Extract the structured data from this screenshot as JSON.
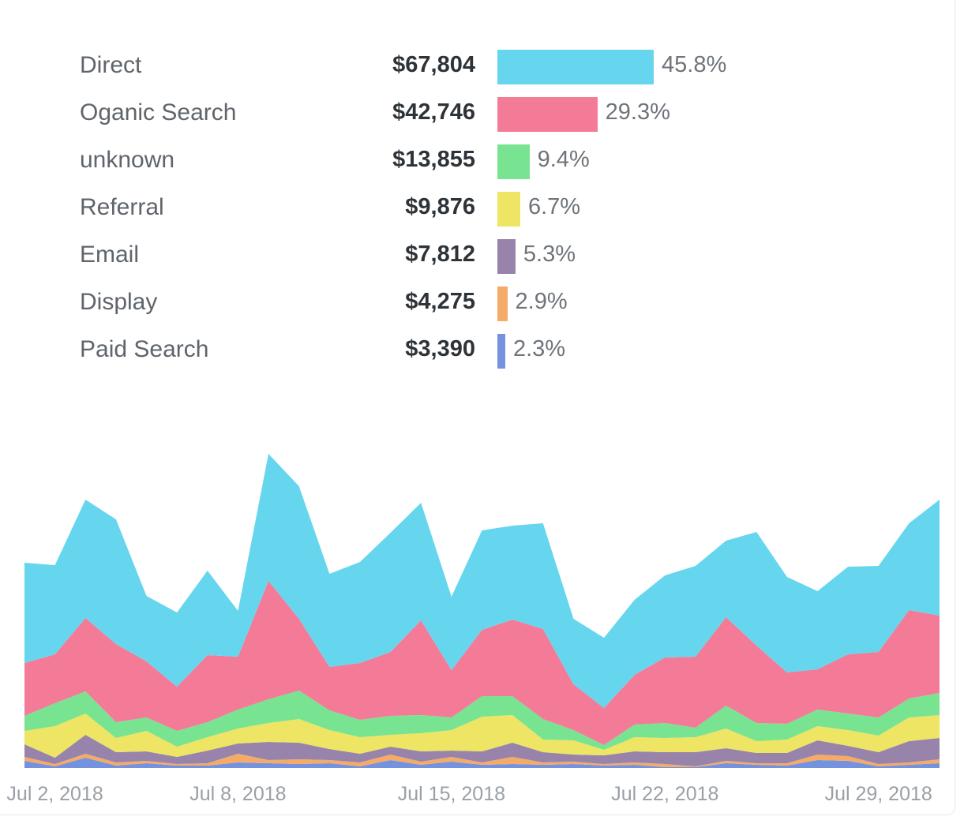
{
  "chart_data": {
    "type": "area",
    "stacked": true,
    "legend_rows": [
      {
        "label": "Direct",
        "amount": "$67,804",
        "percent": "45.8%",
        "share": 45.8,
        "color": "#66d6ee"
      },
      {
        "label": "Oganic Search",
        "amount": "$42,746",
        "percent": "29.3%",
        "share": 29.3,
        "color": "#f47b97"
      },
      {
        "label": "unknown",
        "amount": "$13,855",
        "percent": "9.4%",
        "share": 9.4,
        "color": "#78e391"
      },
      {
        "label": "Referral",
        "amount": "$9,876",
        "percent": "6.7%",
        "share": 6.7,
        "color": "#ede563"
      },
      {
        "label": "Email",
        "amount": "$7,812",
        "percent": "5.3%",
        "share": 5.3,
        "color": "#9884aa"
      },
      {
        "label": "Display",
        "amount": "$4,275",
        "percent": "2.9%",
        "share": 2.9,
        "color": "#f4ab68"
      },
      {
        "label": "Paid Search",
        "amount": "$3,390",
        "percent": "2.3%",
        "share": 2.3,
        "color": "#7492dd"
      }
    ],
    "x": [
      "2018-07-01",
      "2018-07-02",
      "2018-07-03",
      "2018-07-04",
      "2018-07-05",
      "2018-07-06",
      "2018-07-07",
      "2018-07-08",
      "2018-07-09",
      "2018-07-10",
      "2018-07-11",
      "2018-07-12",
      "2018-07-13",
      "2018-07-14",
      "2018-07-15",
      "2018-07-16",
      "2018-07-17",
      "2018-07-18",
      "2018-07-19",
      "2018-07-20",
      "2018-07-21",
      "2018-07-22",
      "2018-07-23",
      "2018-07-24",
      "2018-07-25",
      "2018-07-26",
      "2018-07-27",
      "2018-07-28",
      "2018-07-29",
      "2018-07-30",
      "2018-07-31"
    ],
    "x_tick_labels": [
      "Jul 2, 2018",
      "Jul 8, 2018",
      "Jul 15, 2018",
      "Jul 22, 2018",
      "Jul 29, 2018"
    ],
    "x_tick_dates": [
      "2018-07-02",
      "2018-07-08",
      "2018-07-15",
      "2018-07-22",
      "2018-07-29"
    ],
    "ylim": [
      0,
      400
    ],
    "grid": false,
    "series": [
      {
        "name": "Paid Search",
        "color": "#7492dd",
        "values": [
          9,
          2,
          13,
          3,
          6,
          3,
          3,
          7,
          6,
          5,
          6,
          2,
          10,
          4,
          8,
          4,
          5,
          4,
          5,
          3,
          4,
          1,
          1,
          6,
          4,
          3,
          10,
          9,
          2,
          4,
          6
        ]
      },
      {
        "name": "Display",
        "color": "#f4ab68",
        "values": [
          5,
          3,
          5,
          4,
          3,
          2,
          3,
          11,
          4,
          6,
          4,
          5,
          7,
          4,
          6,
          3,
          9,
          3,
          3,
          2,
          3,
          4,
          1,
          3,
          2,
          3,
          7,
          6,
          3,
          3,
          5
        ]
      },
      {
        "name": "Email",
        "color": "#9884aa",
        "values": [
          16,
          8,
          24,
          13,
          12,
          9,
          16,
          13,
          23,
          21,
          14,
          11,
          10,
          13,
          8,
          14,
          18,
          13,
          9,
          11,
          14,
          15,
          18,
          16,
          13,
          13,
          18,
          13,
          15,
          27,
          27
        ]
      },
      {
        "name": "Referral",
        "color": "#ede563",
        "values": [
          17,
          40,
          27,
          18,
          26,
          13,
          17,
          19,
          24,
          30,
          24,
          21,
          15,
          23,
          26,
          44,
          35,
          16,
          18,
          7,
          18,
          18,
          19,
          25,
          15,
          17,
          18,
          20,
          21,
          30,
          29
        ]
      },
      {
        "name": "unknown",
        "color": "#78e391",
        "values": [
          19,
          29,
          28,
          20,
          17,
          20,
          19,
          24,
          30,
          36,
          25,
          22,
          24,
          23,
          16,
          26,
          24,
          26,
          13,
          6,
          16,
          19,
          12,
          29,
          23,
          20,
          21,
          21,
          23,
          24,
          28
        ]
      },
      {
        "name": "Oganic Search",
        "color": "#f47b97",
        "values": [
          67,
          62,
          93,
          99,
          71,
          56,
          85,
          67,
          150,
          91,
          55,
          72,
          81,
          120,
          60,
          84,
          97,
          114,
          58,
          47,
          63,
          83,
          90,
          112,
          98,
          65,
          51,
          75,
          83,
          112,
          98
        ]
      },
      {
        "name": "Direct",
        "color": "#66d6ee",
        "values": [
          127,
          113,
          150,
          158,
          83,
          94,
          107,
          58,
          161,
          168,
          118,
          128,
          151,
          149,
          93,
          126,
          119,
          134,
          83,
          89,
          95,
          104,
          115,
          97,
          144,
          121,
          99,
          111,
          109,
          110,
          147
        ]
      }
    ]
  }
}
